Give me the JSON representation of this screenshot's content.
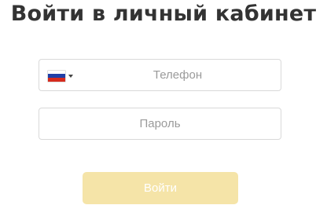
{
  "heading": "Войти в личный кабинет",
  "phone": {
    "country_flag_icon": "russia-flag-icon",
    "dropdown_icon": "caret-down-icon",
    "flag_colors": [
      "#ffffff",
      "#1f3fa8",
      "#d52b1e"
    ],
    "placeholder": "Телефон",
    "value": ""
  },
  "password": {
    "placeholder": "Пароль",
    "value": ""
  },
  "submit": {
    "label": "Войти",
    "background": "#f5e4a8",
    "state": "disabled"
  }
}
